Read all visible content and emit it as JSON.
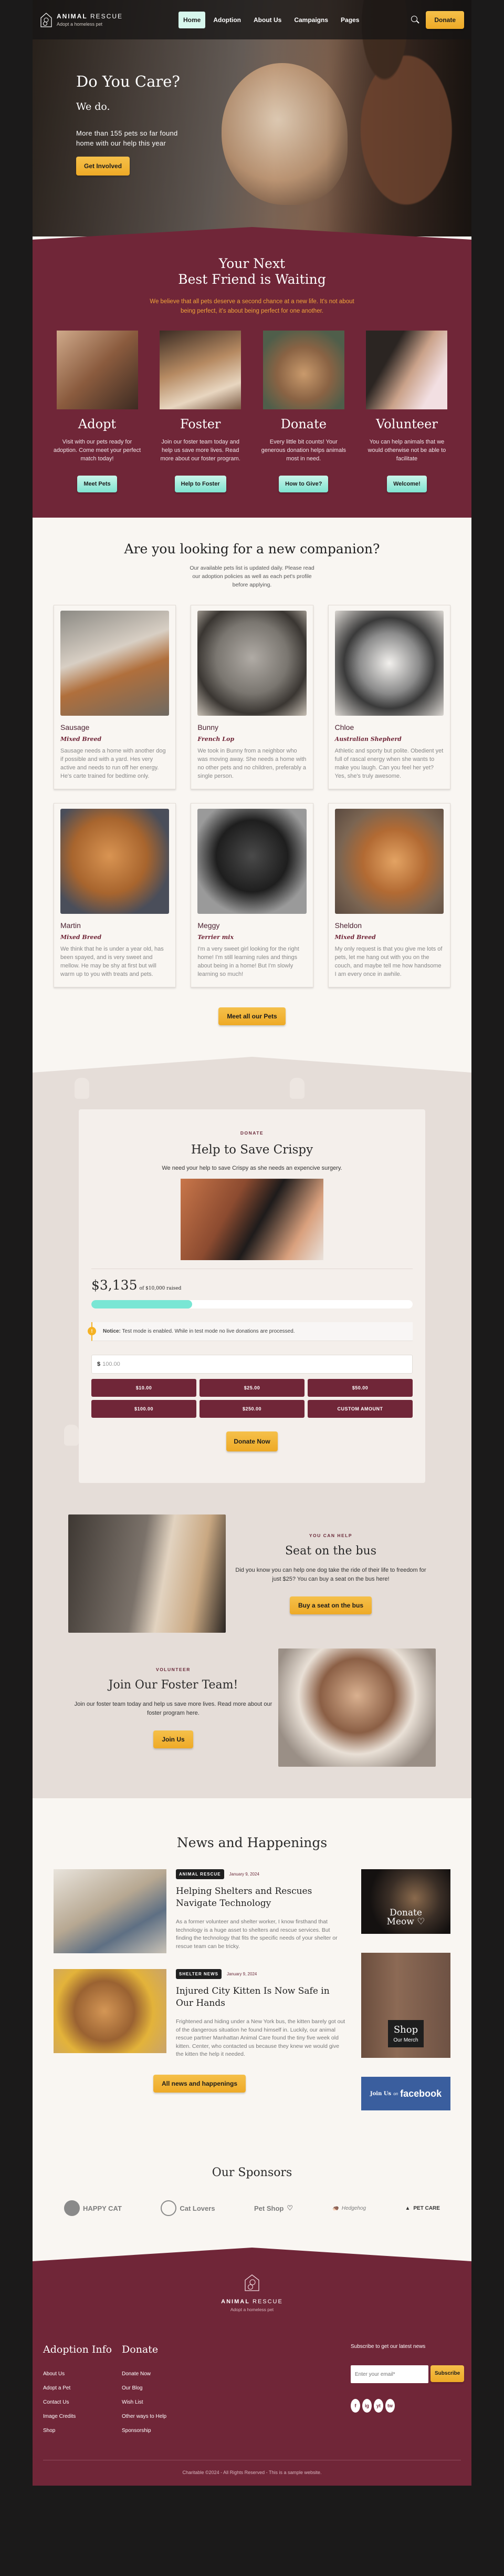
{
  "header": {
    "brand_bold": "ANIMAL",
    "brand_light": "RESCUE",
    "tagline": "Adopt a homeless pet",
    "nav": [
      {
        "label": "Home",
        "active": true
      },
      {
        "label": "Adoption"
      },
      {
        "label": "About Us"
      },
      {
        "label": "Campaigns"
      },
      {
        "label": "Pages"
      }
    ],
    "donate_label": "Donate"
  },
  "hero": {
    "title": "Do You Care?",
    "subtitle": "We do.",
    "text": "More than 155 pets so far found home with our help this year",
    "cta": "Get Involved"
  },
  "intro": {
    "title_line1": "Your Next",
    "title_line2": "Best Friend is Waiting",
    "lead": "We believe that all pets deserve a second chance at a new life. It's not about being perfect, it's about being perfect for one another.",
    "ways": [
      {
        "title": "Adopt",
        "text": "Visit with our pets ready for adoption. Come meet your perfect match today!",
        "button": "Meet Pets"
      },
      {
        "title": "Foster",
        "text": "Join our foster team today and help us save more lives. Read more about our foster program.",
        "button": "Help to Foster"
      },
      {
        "title": "Donate",
        "text": "Every little bit counts! Your generous donation helps animals most in need.",
        "button": "How to Give?"
      },
      {
        "title": "Volunteer",
        "text": "You can help animals that we would otherwise not be able to facilitate",
        "button": "Welcome!"
      }
    ]
  },
  "pets": {
    "title": "Are you looking for a new companion?",
    "subtitle": "Our available pets list is updated daily. Please read our adoption policies as well as each pet's profile before applying.",
    "items": [
      {
        "name": "Sausage",
        "breed": "Mixed Breed",
        "text": "Sausage needs a home with another dog if possible and with a yard. Hes very active and needs to run off her energy. He's carte trained for bedtime only."
      },
      {
        "name": "Bunny",
        "breed": "French Lop",
        "text": "We took in Bunny from a neighbor who was moving away. She needs a home with no other pets and no children, preferably a single person."
      },
      {
        "name": "Chloe",
        "breed": "Australian Shepherd",
        "text": "Athletic and sporty but polite. Obedient yet full of rascal energy when she wants to make you laugh. Can you feel her yet? Yes, she's truly awesome."
      },
      {
        "name": "Martin",
        "breed": "Mixed Breed",
        "text": "We think that he is under a year old, has been spayed, and is very sweet and mellow. He may be shy at first but will warm up to you with treats and pets."
      },
      {
        "name": "Meggy",
        "breed": "Terrier mix",
        "text": "I'm a very sweet girl looking for the right home! I'm still learning rules and things about being in a home! But I'm slowly learning so much!"
      },
      {
        "name": "Sheldon",
        "breed": "Mixed Breed",
        "text": "My only request is that you give me lots of pets, let me hang out with you on the couch, and maybe tell me how handsome I am every once in awhile."
      }
    ],
    "cta": "Meet all our Pets"
  },
  "donation": {
    "kicker": "DONATE",
    "title": "Help to Save Crispy",
    "subtitle": "We need your help to save Crispy as she needs an expencive surgery.",
    "raised": "$3,135",
    "goal_text": "of $10,000 raised",
    "progress_percent": 31.35,
    "notice_label": "Notice:",
    "notice_text": "Test mode is enabled. While in test mode no live donations are processed.",
    "currency": "$",
    "amount_value": "100.00",
    "levels": [
      "$10.00",
      "$25.00",
      "$50.00",
      "$100.00",
      "$250.00",
      "CUSTOM AMOUNT"
    ],
    "cta": "Donate Now"
  },
  "bus": {
    "kicker": "YOU CAN HELP",
    "title": "Seat on the bus",
    "text": "Did you know you can help one dog take the ride of their life to freedom for just $25? You can buy a seat on the bus here!",
    "cta": "Buy a seat on the bus"
  },
  "foster": {
    "kicker": "VOLUNTEER",
    "title": "Join Our Foster Team!",
    "text": "Join our foster team today and help us save more lives. Read more about our foster program here.",
    "cta": "Join Us"
  },
  "news": {
    "title": "News and Happenings",
    "articles": [
      {
        "category": "ANIMAL RESCUE",
        "date": "January 9, 2024",
        "title": "Helping Shelters and Rescues Navigate Technology",
        "excerpt": "As a former volunteer and shelter worker, I know firsthand that technology is a huge asset to shelters and rescue services. But finding the technology that fits the specific needs of your shelter or rescue team can be tricky."
      },
      {
        "category": "SHELTER NEWS",
        "date": "January 9, 2024",
        "title": "Injured City Kitten Is Now Safe in Our Hands",
        "excerpt": "Frightened and hiding under a New York bus, the kitten barely got out of the dangerous situation he found himself in. Luckily, our animal rescue partner Manhattan Animal Care found the tiny five week old kitten. Center, who contacted us because they knew we would give the kitten the help it needed."
      }
    ],
    "cta": "All news and happenings",
    "ads": {
      "donate_line1": "Donate",
      "donate_line2": "Meow",
      "shop_line1": "Shop",
      "shop_line2": "Our Merch",
      "fb_prefix": "Join Us",
      "fb_on": "on",
      "fb_brand": "facebook"
    }
  },
  "sponsors": {
    "title": "Our Sponsors",
    "logos": [
      "HAPPY CAT",
      "Cat Lovers",
      "Pet Shop",
      "Hedgehog",
      "PET CARE"
    ]
  },
  "footer": {
    "brand_bold": "ANIMAL",
    "brand_light": "RESCUE",
    "tagline": "Adopt a homeless pet",
    "col1_title": "Adoption Info",
    "col1_links": [
      "About Us",
      "Adopt a Pet",
      "Contact Us",
      "Image Credits",
      "Shop"
    ],
    "col2_title": "Donate",
    "col2_links": [
      "Donate Now",
      "Our Blog",
      "Wish List",
      "Other ways to Help",
      "Sponsorship"
    ],
    "subscribe_label": "Subscribe to get our latest news",
    "email_placeholder": "Enter your email*",
    "subscribe_button": "Subscribe",
    "social": [
      "f",
      "ig",
      "yt",
      "tw"
    ],
    "copyright": "Charitable ©2024 - All Rights Reserved - This is a sample website."
  }
}
